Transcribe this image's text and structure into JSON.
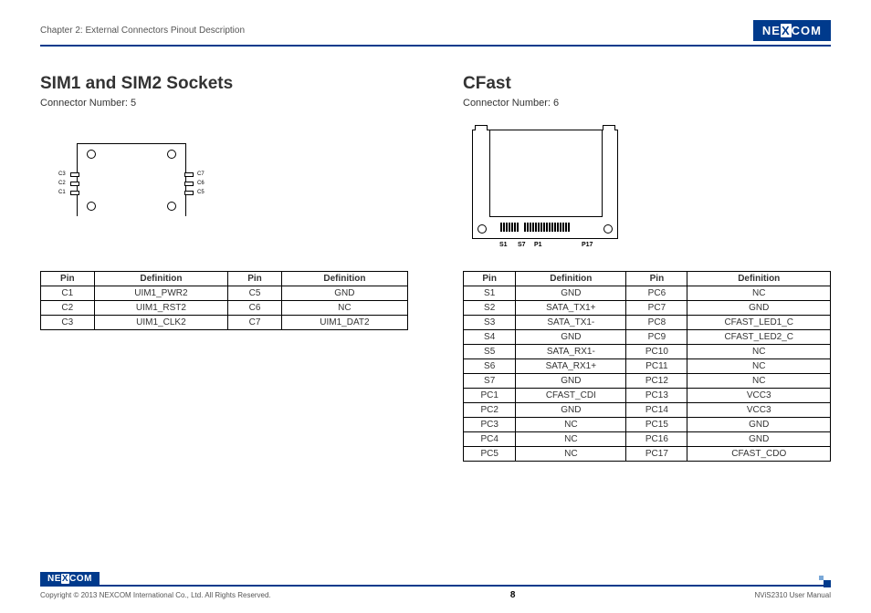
{
  "header": {
    "chapter": "Chapter 2: External Connectors Pinout Description",
    "logo_text": "NE COM",
    "logo_x": "X"
  },
  "footer": {
    "copyright": "Copyright © 2013 NEXCOM International Co., Ltd. All Rights Reserved.",
    "page": "8",
    "manual": "NViS2310 User Manual"
  },
  "sim": {
    "title": "SIM1 and SIM2 Sockets",
    "subtitle": "Connector Number: 5",
    "pin_labels": {
      "C1": "C1",
      "C2": "C2",
      "C3": "C3",
      "C5": "C5",
      "C6": "C6",
      "C7": "C7"
    },
    "table": {
      "headers": [
        "Pin",
        "Definition",
        "Pin",
        "Definition"
      ],
      "rows": [
        [
          "C1",
          "UIM1_PWR2",
          "C5",
          "GND"
        ],
        [
          "C2",
          "UIM1_RST2",
          "C6",
          "NC"
        ],
        [
          "C3",
          "UIM1_CLK2",
          "C7",
          "UIM1_DAT2"
        ]
      ]
    }
  },
  "cfast": {
    "title": "CFast",
    "subtitle": "Connector Number: 6",
    "pin_labels": {
      "S1": "S1",
      "S7": "S7",
      "P1": "P1",
      "P17": "P17"
    },
    "table": {
      "headers": [
        "Pin",
        "Definition",
        "Pin",
        "Definition"
      ],
      "rows": [
        [
          "S1",
          "GND",
          "PC6",
          "NC"
        ],
        [
          "S2",
          "SATA_TX1+",
          "PC7",
          "GND"
        ],
        [
          "S3",
          "SATA_TX1-",
          "PC8",
          "CFAST_LED1_C"
        ],
        [
          "S4",
          "GND",
          "PC9",
          "CFAST_LED2_C"
        ],
        [
          "S5",
          "SATA_RX1-",
          "PC10",
          "NC"
        ],
        [
          "S6",
          "SATA_RX1+",
          "PC11",
          "NC"
        ],
        [
          "S7",
          "GND",
          "PC12",
          "NC"
        ],
        [
          "PC1",
          "CFAST_CDI",
          "PC13",
          "VCC3"
        ],
        [
          "PC2",
          "GND",
          "PC14",
          "VCC3"
        ],
        [
          "PC3",
          "NC",
          "PC15",
          "GND"
        ],
        [
          "PC4",
          "NC",
          "PC16",
          "GND"
        ],
        [
          "PC5",
          "NC",
          "PC17",
          "CFAST_CDO"
        ]
      ]
    }
  }
}
